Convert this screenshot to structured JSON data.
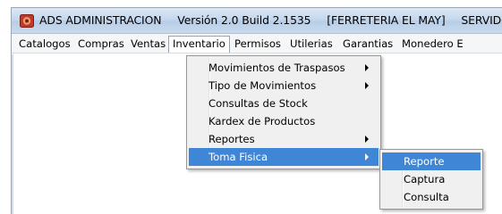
{
  "window": {
    "title_app": "ADS ADMINISTRACION",
    "title_version": "Versión 2.0 Build 2.1535",
    "title_store": "[FERRETERIA EL MAY]",
    "title_server": "SERVIDOR :"
  },
  "menubar": {
    "items": [
      {
        "label": "Catalogos"
      },
      {
        "label": "Compras"
      },
      {
        "label": "Ventas"
      },
      {
        "label": "Inventario"
      },
      {
        "label": "Permisos"
      },
      {
        "label": "Utilerias"
      },
      {
        "label": "Garantias"
      },
      {
        "label": "Monedero E"
      }
    ],
    "open_item": "Inventario"
  },
  "inventario_menu": {
    "items": [
      {
        "label": "Movimientos de Traspasos",
        "has_submenu": true
      },
      {
        "label": "Tipo de Movimientos",
        "has_submenu": true
      },
      {
        "label": "Consultas de Stock",
        "has_submenu": false
      },
      {
        "label": "Kardex de Productos",
        "has_submenu": false
      },
      {
        "label": "Reportes",
        "has_submenu": true
      },
      {
        "label": "Toma Fisica",
        "has_submenu": true
      }
    ],
    "highlighted": "Toma Fisica"
  },
  "toma_fisica_menu": {
    "items": [
      {
        "label": "Reporte"
      },
      {
        "label": "Captura"
      },
      {
        "label": "Consulta"
      }
    ],
    "highlighted": "Reporte"
  },
  "colors": {
    "highlight": "#3f86d6",
    "menu_bg": "#f0f0f0",
    "titlebar": "#c5d8ee"
  },
  "icons": {
    "app": "app-logo-icon",
    "submenu": "chevron-right-icon"
  }
}
